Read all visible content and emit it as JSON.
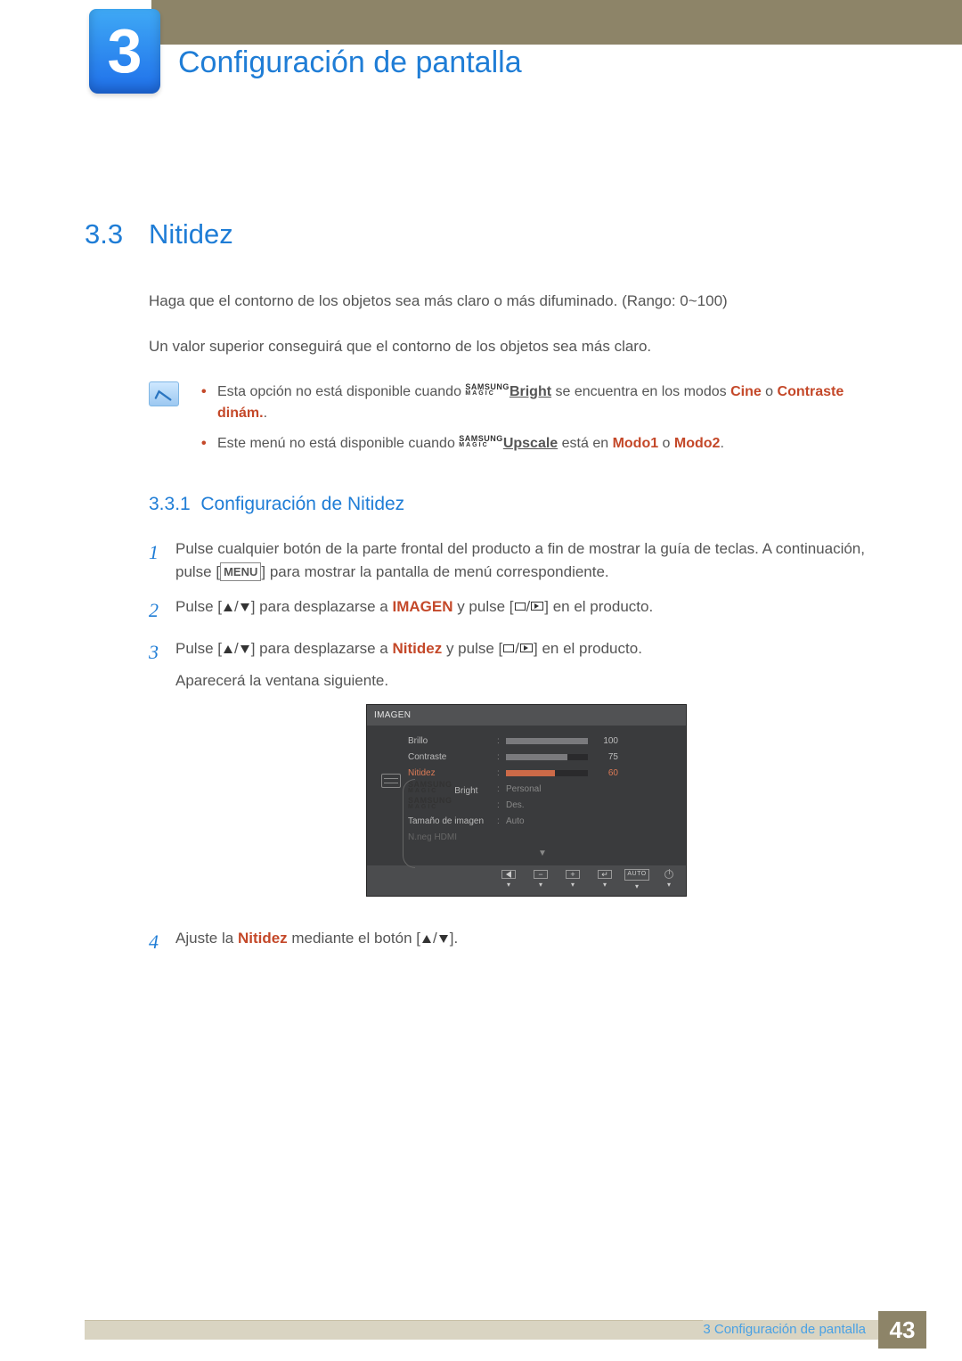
{
  "chapter": {
    "number": "3",
    "title": "Configuración de pantalla"
  },
  "section": {
    "number": "3.3",
    "title": "Nitidez"
  },
  "intro": {
    "p1": "Haga que el contorno de los objetos sea más claro o más difuminado. (Rango: 0~100)",
    "p2": "Un valor superior conseguirá que el contorno de los objetos sea más claro."
  },
  "notes": {
    "n1_pre": "Esta opción no está disponible cuando ",
    "magic_label_top": "SAMSUNG",
    "magic_label_bot": "MAGIC",
    "bright": "Bright",
    "n1_mid": " se encuentra en los modos ",
    "cine": "Cine",
    "n1_or": " o ",
    "contraste": "Contraste dinám.",
    "n1_end": ".",
    "n2_pre": "Este menú no está disponible cuando ",
    "upscale": "Upscale",
    "n2_mid": " está en ",
    "modo1": "Modo1",
    "modo2": "Modo2",
    "n2_end": "."
  },
  "subsection": {
    "number": "3.3.1",
    "title": "Configuración de Nitidez"
  },
  "steps": {
    "s1a": "Pulse cualquier botón de la parte frontal del producto a fin de mostrar la guía de teclas. A continuación, pulse [",
    "menu_btn": "MENU",
    "s1b": "] para mostrar la pantalla de menú correspondiente.",
    "s2a": "Pulse [",
    "s2b": "] para desplazarse a ",
    "imagen": "IMAGEN",
    "s2c": " y pulse [",
    "s2d": "] en el producto.",
    "s3a": "Pulse [",
    "s3b": "] para desplazarse a ",
    "nitidez": "Nitidez",
    "s3c": " y pulse [",
    "s3d": "] en el producto.",
    "s3e": "Aparecerá la ventana siguiente.",
    "s4a": "Ajuste la ",
    "s4b": " mediante el botón [",
    "s4c": "]."
  },
  "osd": {
    "title": "IMAGEN",
    "rows": {
      "brillo": {
        "label": "Brillo",
        "value": "100",
        "fill": 100
      },
      "contraste": {
        "label": "Contraste",
        "value": "75",
        "fill": 75
      },
      "nitidez": {
        "label": "Nitidez",
        "value": "60",
        "fill": 60
      },
      "magic_bright": {
        "label": " Bright",
        "value": "Personal"
      },
      "magic": {
        "label": "",
        "value": "Des."
      },
      "tam": {
        "label": "Tamaño de imagen",
        "value": "Auto"
      },
      "hdmi": {
        "label": "N.neg HDMI"
      }
    },
    "footer": {
      "minus": "−",
      "plus": "+",
      "enter": "↵",
      "auto": "AUTO"
    }
  },
  "footer": {
    "label": "3 Configuración de pantalla",
    "page": "43"
  },
  "chart_data": {
    "type": "bar",
    "title": "IMAGEN OSD sliders",
    "categories": [
      "Brillo",
      "Contraste",
      "Nitidez"
    ],
    "values": [
      100,
      75,
      60
    ],
    "ylim": [
      0,
      100
    ],
    "xlabel": "",
    "ylabel": ""
  }
}
